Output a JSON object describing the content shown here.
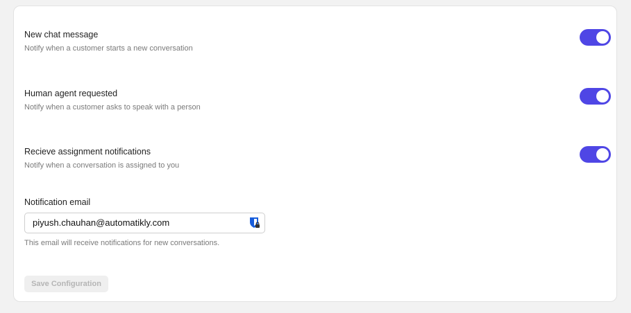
{
  "settings": [
    {
      "title": "New chat message",
      "description": "Notify when a customer starts a new conversation",
      "enabled": true
    },
    {
      "title": "Human agent requested",
      "description": "Notify when a customer asks to speak with a person",
      "enabled": true
    },
    {
      "title": "Recieve assignment notifications",
      "description": "Notify when a conversation is assigned to you",
      "enabled": true
    }
  ],
  "email": {
    "label": "Notification email",
    "value": "piyush.chauhan@automatikly.com",
    "help": "This email will receive notifications for new conversations.",
    "autofill_icon": "bitwarden-shield-lock-icon"
  },
  "actions": {
    "save_label": "Save Configuration",
    "save_disabled": true
  },
  "colors": {
    "toggle_on": "#4f46e5",
    "page_bg": "#f2f2f2"
  }
}
